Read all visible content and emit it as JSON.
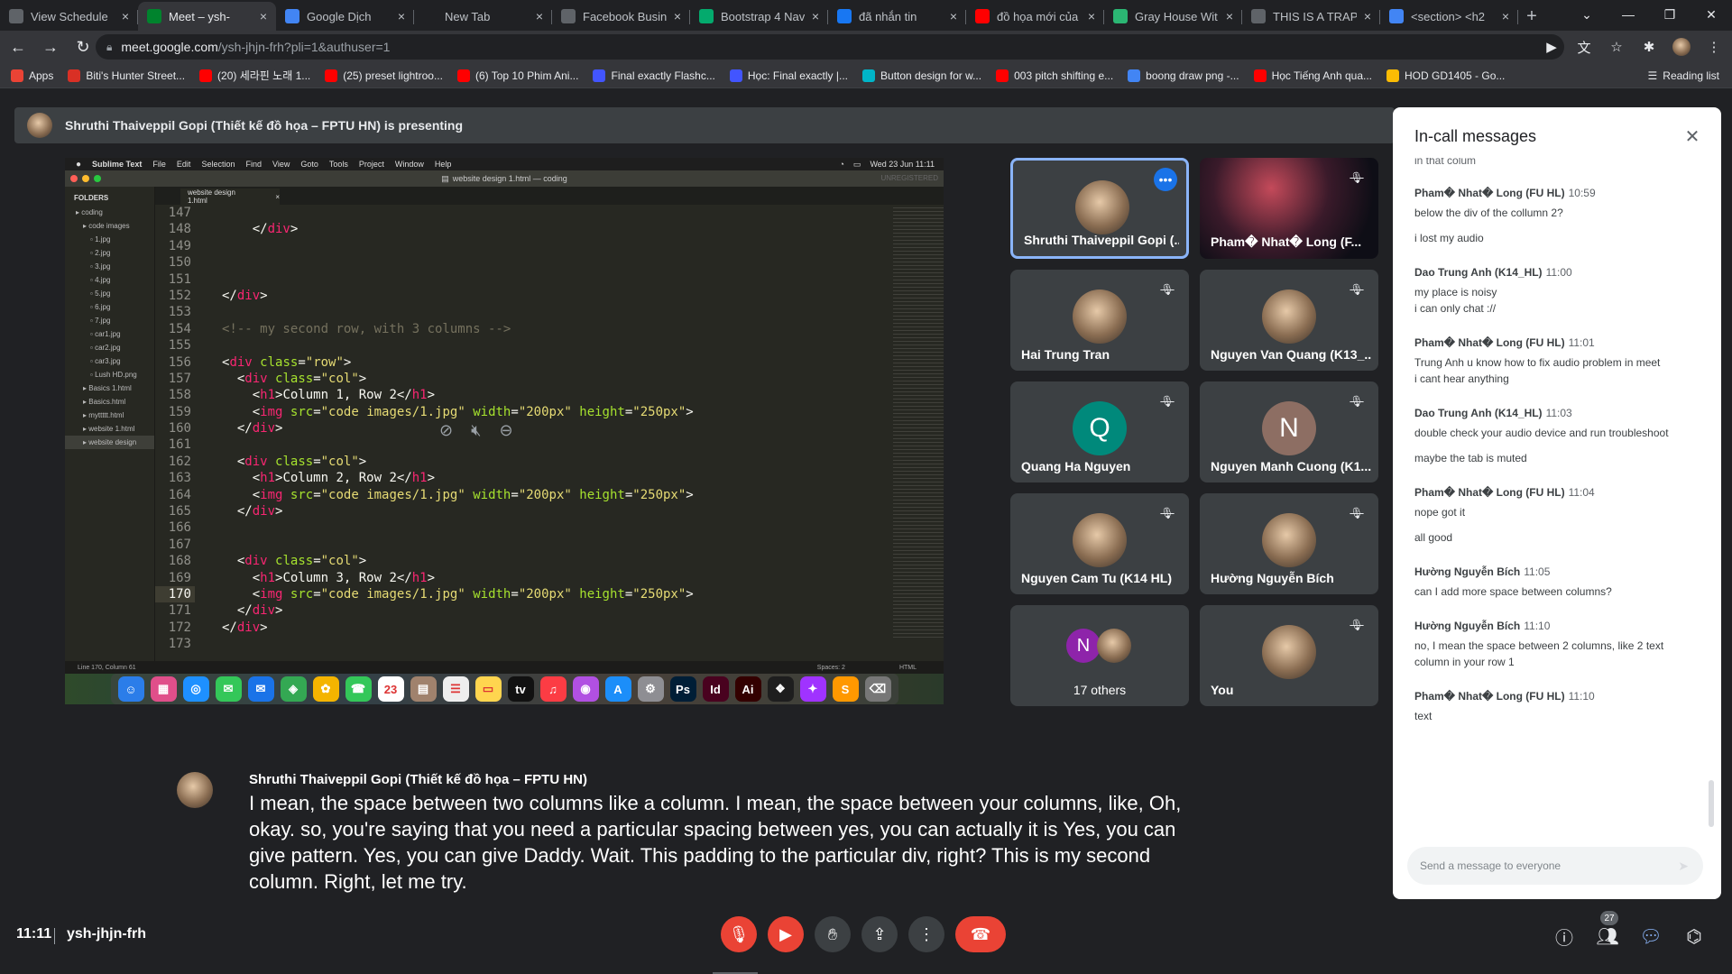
{
  "browser": {
    "tabs": [
      {
        "title": "View Schedule",
        "fav_color": "#5f6368"
      },
      {
        "title": "Meet – ysh-",
        "fav_color": "#00832d",
        "active": true
      },
      {
        "title": "Google Dịch",
        "fav_color": "#4285f4"
      },
      {
        "title": "New Tab",
        "fav_color": "#202124"
      },
      {
        "title": "Facebook Busine",
        "fav_color": "#5f6368"
      },
      {
        "title": "Bootstrap 4 Nav",
        "fav_color": "#04aa6d"
      },
      {
        "title": "đã nhắn tin",
        "fav_color": "#1877f2"
      },
      {
        "title": "đồ họa mới của",
        "fav_color": "#ff0000"
      },
      {
        "title": "Gray House Wit",
        "fav_color": "#2bb673"
      },
      {
        "title": "THIS IS A TRAP",
        "fav_color": "#5f6368"
      },
      {
        "title": "<section> <h2",
        "fav_color": "#4285f4"
      }
    ],
    "url_host": "meet.google.com",
    "url_path": "/ysh-jhjn-frh?pli=1&authuser=1",
    "bookmarks": [
      {
        "label": "Apps",
        "color": "#ea4335"
      },
      {
        "label": "Biti's Hunter Street...",
        "color": "#d93025"
      },
      {
        "label": "(20) 세라핀 노래 1...",
        "color": "#ff0000"
      },
      {
        "label": "(25) preset lightroo...",
        "color": "#ff0000"
      },
      {
        "label": "(6) Top 10 Phim Ani...",
        "color": "#ff0000"
      },
      {
        "label": "Final exactly Flashc...",
        "color": "#4255ff"
      },
      {
        "label": "Học: Final exactly |...",
        "color": "#4255ff"
      },
      {
        "label": "Button design for w...",
        "color": "#00b5c8"
      },
      {
        "label": "003 pitch shifting e...",
        "color": "#ff0000"
      },
      {
        "label": "boong draw png -...",
        "color": "#4285f4"
      },
      {
        "label": "Học Tiếng Anh qua...",
        "color": "#ff0000"
      },
      {
        "label": "HOD GD1405 - Go...",
        "color": "#fbbc04"
      }
    ],
    "reading_list": "Reading list"
  },
  "presenting_banner": "Shruthi Thaiveppil Gopi (Thiết kế đồ họa – FPTU HN) is presenting",
  "shared_screen": {
    "menubar": [
      "Sublime Text",
      "File",
      "Edit",
      "Selection",
      "Find",
      "View",
      "Goto",
      "Tools",
      "Project",
      "Window",
      "Help"
    ],
    "menubar_clock": "Wed 23 Jun  11:11",
    "window_title": "website design 1.html — coding",
    "unregistered": "UNREGISTERED",
    "folders_header": "FOLDERS",
    "files": [
      {
        "name": "coding",
        "indent": 1
      },
      {
        "name": "code images",
        "indent": 2
      },
      {
        "name": "1.jpg",
        "indent": 3
      },
      {
        "name": "2.jpg",
        "indent": 3
      },
      {
        "name": "3.jpg",
        "indent": 3
      },
      {
        "name": "4.jpg",
        "indent": 3
      },
      {
        "name": "5.jpg",
        "indent": 3
      },
      {
        "name": "6.jpg",
        "indent": 3
      },
      {
        "name": "7.jpg",
        "indent": 3
      },
      {
        "name": "car1.jpg",
        "indent": 3
      },
      {
        "name": "car2.jpg",
        "indent": 3
      },
      {
        "name": "car3.jpg",
        "indent": 3
      },
      {
        "name": "Lush HD.png",
        "indent": 3
      },
      {
        "name": "Basics 1.html",
        "indent": 2
      },
      {
        "name": "Basics.html",
        "indent": 2
      },
      {
        "name": "myttttt.html",
        "indent": 2
      },
      {
        "name": "website 1.html",
        "indent": 2
      },
      {
        "name": "website design",
        "indent": 2,
        "selected": true
      }
    ],
    "editor_tab": "website design 1.html",
    "line_numbers": [
      "147",
      "148",
      "149",
      "150",
      "151",
      "152",
      "153",
      "154",
      "155",
      "156",
      "157",
      "158",
      "159",
      "160",
      "161",
      "162",
      "163",
      "164",
      "165",
      "166",
      "167",
      "168",
      "169",
      "170",
      "171",
      "172",
      "173"
    ],
    "current_line": "170",
    "code_lines": [
      {
        "segs": []
      },
      {
        "segs": [
          {
            "c": "tx",
            "t": "    </"
          },
          {
            "c": "tg",
            "t": "div"
          },
          {
            "c": "tx",
            "t": ">"
          }
        ]
      },
      {
        "segs": []
      },
      {
        "segs": []
      },
      {
        "segs": []
      },
      {
        "segs": [
          {
            "c": "tx",
            "t": "</"
          },
          {
            "c": "tg",
            "t": "div"
          },
          {
            "c": "tx",
            "t": ">"
          }
        ]
      },
      {
        "segs": []
      },
      {
        "segs": [
          {
            "c": "cm",
            "t": "<!-- my second row, with 3 columns -->"
          }
        ]
      },
      {
        "segs": []
      },
      {
        "segs": [
          {
            "c": "tx",
            "t": "<"
          },
          {
            "c": "tg",
            "t": "div"
          },
          {
            "c": "tx",
            "t": " "
          },
          {
            "c": "at",
            "t": "class"
          },
          {
            "c": "tx",
            "t": "="
          },
          {
            "c": "st",
            "t": "\"row\""
          },
          {
            "c": "tx",
            "t": ">"
          }
        ]
      },
      {
        "segs": [
          {
            "c": "tx",
            "t": "  <"
          },
          {
            "c": "tg",
            "t": "div"
          },
          {
            "c": "tx",
            "t": " "
          },
          {
            "c": "at",
            "t": "class"
          },
          {
            "c": "tx",
            "t": "="
          },
          {
            "c": "st",
            "t": "\"col\""
          },
          {
            "c": "tx",
            "t": ">"
          }
        ]
      },
      {
        "segs": [
          {
            "c": "tx",
            "t": "    <"
          },
          {
            "c": "tg",
            "t": "h1"
          },
          {
            "c": "tx",
            "t": ">Column 1, Row 2</"
          },
          {
            "c": "tg",
            "t": "h1"
          },
          {
            "c": "tx",
            "t": ">"
          }
        ]
      },
      {
        "segs": [
          {
            "c": "tx",
            "t": "    <"
          },
          {
            "c": "tg",
            "t": "img"
          },
          {
            "c": "tx",
            "t": " "
          },
          {
            "c": "at",
            "t": "src"
          },
          {
            "c": "tx",
            "t": "="
          },
          {
            "c": "st",
            "t": "\"code images/1.jpg\""
          },
          {
            "c": "tx",
            "t": " "
          },
          {
            "c": "at",
            "t": "width"
          },
          {
            "c": "tx",
            "t": "="
          },
          {
            "c": "st",
            "t": "\"200px\""
          },
          {
            "c": "tx",
            "t": " "
          },
          {
            "c": "at",
            "t": "height"
          },
          {
            "c": "tx",
            "t": "="
          },
          {
            "c": "st",
            "t": "\"250px\""
          },
          {
            "c": "tx",
            "t": ">"
          }
        ]
      },
      {
        "segs": [
          {
            "c": "tx",
            "t": "  </"
          },
          {
            "c": "tg",
            "t": "div"
          },
          {
            "c": "tx",
            "t": ">"
          }
        ]
      },
      {
        "segs": []
      },
      {
        "segs": [
          {
            "c": "tx",
            "t": "  <"
          },
          {
            "c": "tg",
            "t": "div"
          },
          {
            "c": "tx",
            "t": " "
          },
          {
            "c": "at",
            "t": "class"
          },
          {
            "c": "tx",
            "t": "="
          },
          {
            "c": "st",
            "t": "\"col\""
          },
          {
            "c": "tx",
            "t": ">"
          }
        ]
      },
      {
        "segs": [
          {
            "c": "tx",
            "t": "    <"
          },
          {
            "c": "tg",
            "t": "h1"
          },
          {
            "c": "tx",
            "t": ">Column 2, Row 2</"
          },
          {
            "c": "tg",
            "t": "h1"
          },
          {
            "c": "tx",
            "t": ">"
          }
        ]
      },
      {
        "segs": [
          {
            "c": "tx",
            "t": "    <"
          },
          {
            "c": "tg",
            "t": "img"
          },
          {
            "c": "tx",
            "t": " "
          },
          {
            "c": "at",
            "t": "src"
          },
          {
            "c": "tx",
            "t": "="
          },
          {
            "c": "st",
            "t": "\"code images/1.jpg\""
          },
          {
            "c": "tx",
            "t": " "
          },
          {
            "c": "at",
            "t": "width"
          },
          {
            "c": "tx",
            "t": "="
          },
          {
            "c": "st",
            "t": "\"200px\""
          },
          {
            "c": "tx",
            "t": " "
          },
          {
            "c": "at",
            "t": "height"
          },
          {
            "c": "tx",
            "t": "="
          },
          {
            "c": "st",
            "t": "\"250px\""
          },
          {
            "c": "tx",
            "t": ">"
          }
        ]
      },
      {
        "segs": [
          {
            "c": "tx",
            "t": "  </"
          },
          {
            "c": "tg",
            "t": "div"
          },
          {
            "c": "tx",
            "t": ">"
          }
        ]
      },
      {
        "segs": []
      },
      {
        "segs": []
      },
      {
        "segs": [
          {
            "c": "tx",
            "t": "  <"
          },
          {
            "c": "tg",
            "t": "div"
          },
          {
            "c": "tx",
            "t": " "
          },
          {
            "c": "at",
            "t": "class"
          },
          {
            "c": "tx",
            "t": "="
          },
          {
            "c": "st",
            "t": "\"col\""
          },
          {
            "c": "tx",
            "t": ">"
          }
        ]
      },
      {
        "segs": [
          {
            "c": "tx",
            "t": "    <"
          },
          {
            "c": "tg",
            "t": "h1"
          },
          {
            "c": "tx",
            "t": ">Column 3, Row 2</"
          },
          {
            "c": "tg",
            "t": "h1"
          },
          {
            "c": "tx",
            "t": ">"
          }
        ]
      },
      {
        "segs": [
          {
            "c": "tx",
            "t": "    <"
          },
          {
            "c": "tg",
            "t": "img"
          },
          {
            "c": "tx",
            "t": " "
          },
          {
            "c": "at",
            "t": "src"
          },
          {
            "c": "tx",
            "t": "="
          },
          {
            "c": "st",
            "t": "\"code images/1.jpg\""
          },
          {
            "c": "tx",
            "t": " "
          },
          {
            "c": "at",
            "t": "width"
          },
          {
            "c": "tx",
            "t": "="
          },
          {
            "c": "st",
            "t": "\"200px\""
          },
          {
            "c": "tx",
            "t": " "
          },
          {
            "c": "at",
            "t": "height"
          },
          {
            "c": "tx",
            "t": "="
          },
          {
            "c": "st",
            "t": "\"250px\""
          },
          {
            "c": "tx",
            "t": ">"
          }
        ]
      },
      {
        "segs": [
          {
            "c": "tx",
            "t": "  </"
          },
          {
            "c": "tg",
            "t": "div"
          },
          {
            "c": "tx",
            "t": ">"
          }
        ]
      },
      {
        "segs": [
          {
            "c": "tx",
            "t": "</"
          },
          {
            "c": "tg",
            "t": "div"
          },
          {
            "c": "tx",
            "t": ">"
          }
        ]
      },
      {
        "segs": []
      }
    ],
    "status_left": "Line 170, Column 61",
    "status_spaces": "Spaces: 2",
    "status_syntax": "HTML",
    "dock": [
      {
        "g": "☺",
        "c": "#2b7de9"
      },
      {
        "g": "▦",
        "c": "#e04f8a"
      },
      {
        "g": "◎",
        "c": "#1e90ff"
      },
      {
        "g": "✉",
        "c": "#34c759"
      },
      {
        "g": "✉",
        "c": "#1a73e8"
      },
      {
        "g": "◈",
        "c": "#34a853"
      },
      {
        "g": "✿",
        "c": "#f4b400"
      },
      {
        "g": "☎",
        "c": "#34c759"
      },
      {
        "g": "23",
        "c": "#ffffff"
      },
      {
        "g": "▤",
        "c": "#a0826d"
      },
      {
        "g": "☰",
        "c": "#eeeeee"
      },
      {
        "g": "▭",
        "c": "#ffd54f"
      },
      {
        "g": "tv",
        "c": "#111111"
      },
      {
        "g": "♫",
        "c": "#fc3c44"
      },
      {
        "g": "◉",
        "c": "#b150e2"
      },
      {
        "g": "A",
        "c": "#1c8ef9"
      },
      {
        "g": "⚙",
        "c": "#8e8e93"
      },
      {
        "g": "Ps",
        "c": "#001e36"
      },
      {
        "g": "Id",
        "c": "#49021f"
      },
      {
        "g": "Ai",
        "c": "#330000"
      },
      {
        "g": "❖",
        "c": "#1e1e1e"
      },
      {
        "g": "✦",
        "c": "#a033ff"
      },
      {
        "g": "S",
        "c": "#ff9800"
      },
      {
        "g": "⌫",
        "c": "#777777"
      }
    ]
  },
  "participants": [
    {
      "name": "Shruthi Thaiveppil Gopi (...",
      "speaking": true,
      "muted": false,
      "avatar": "photo"
    },
    {
      "name": "Pham� Nhat� Long (F...",
      "muted": true,
      "avatar": "video"
    },
    {
      "name": "Hai Trung Tran",
      "muted": true,
      "avatar": "photo"
    },
    {
      "name": "Nguyen Van Quang (K13_...",
      "muted": true,
      "avatar": "photo"
    },
    {
      "name": "Quang Ha Nguyen",
      "muted": true,
      "avatar": "letter",
      "letter": "Q",
      "color": "#00897b"
    },
    {
      "name": "Nguyen Manh Cuong (K1...",
      "muted": true,
      "avatar": "letter",
      "letter": "N",
      "color": "#8d6e63"
    },
    {
      "name": "Nguyen Cam Tu (K14 HL)",
      "muted": true,
      "avatar": "photo"
    },
    {
      "name": "Hường Nguyễn Bích",
      "muted": true,
      "avatar": "photo"
    },
    {
      "name": "17 others",
      "avatar": "others",
      "letter": "N",
      "color": "#8e24aa"
    },
    {
      "name": "You",
      "muted": true,
      "avatar": "photo"
    }
  ],
  "chat": {
    "title": "In-call messages",
    "top_fragment": "in that colum",
    "messages": [
      {
        "sender": "Pham� Nhat� Long (FU HL)",
        "time": "10:59",
        "lines": [
          "below the div of the collumn 2?",
          "i lost my audio"
        ]
      },
      {
        "sender": "Dao Trung Anh (K14_HL)",
        "time": "11:00",
        "lines": [
          "my place is noisy\ni can only chat ://"
        ]
      },
      {
        "sender": "Pham� Nhat� Long (FU HL)",
        "time": "11:01",
        "lines": [
          "Trung Anh u know how to fix audio problem in meet\ni cant hear anything"
        ]
      },
      {
        "sender": "Dao Trung Anh (K14_HL)",
        "time": "11:03",
        "lines": [
          "double check your audio device and run troubleshoot",
          "maybe the tab is muted"
        ]
      },
      {
        "sender": "Pham� Nhat� Long (FU HL)",
        "time": "11:04",
        "lines": [
          "nope got it",
          "all good"
        ]
      },
      {
        "sender": "Hường Nguyễn Bích",
        "time": "11:05",
        "lines": [
          "can I add more space between columns?"
        ]
      },
      {
        "sender": "Hường Nguyễn Bích",
        "time": "11:10",
        "lines": [
          "no, I mean the space between 2 columns, like 2 text column in your row 1"
        ]
      },
      {
        "sender": "Pham� Nhat� Long (FU HL)",
        "time": "11:10",
        "lines": [
          "text"
        ]
      }
    ],
    "input_placeholder": "Send a message to everyone"
  },
  "captions": {
    "speaker": "Shruthi Thaiveppil Gopi (Thiết kế đồ họa – FPTU HN)",
    "text": "I mean, the space between two columns like a column. I mean, the space between your columns, like, Oh, okay. so, you're saying that you need a particular spacing between yes, you can actually it is Yes, you can give pattern. Yes, you can give Daddy. Wait. This padding to the particular div, right? This is my second column. Right, let me try."
  },
  "bottom": {
    "time": "11:11",
    "meeting_code": "ysh-jhjn-frh",
    "participant_count": "27"
  }
}
